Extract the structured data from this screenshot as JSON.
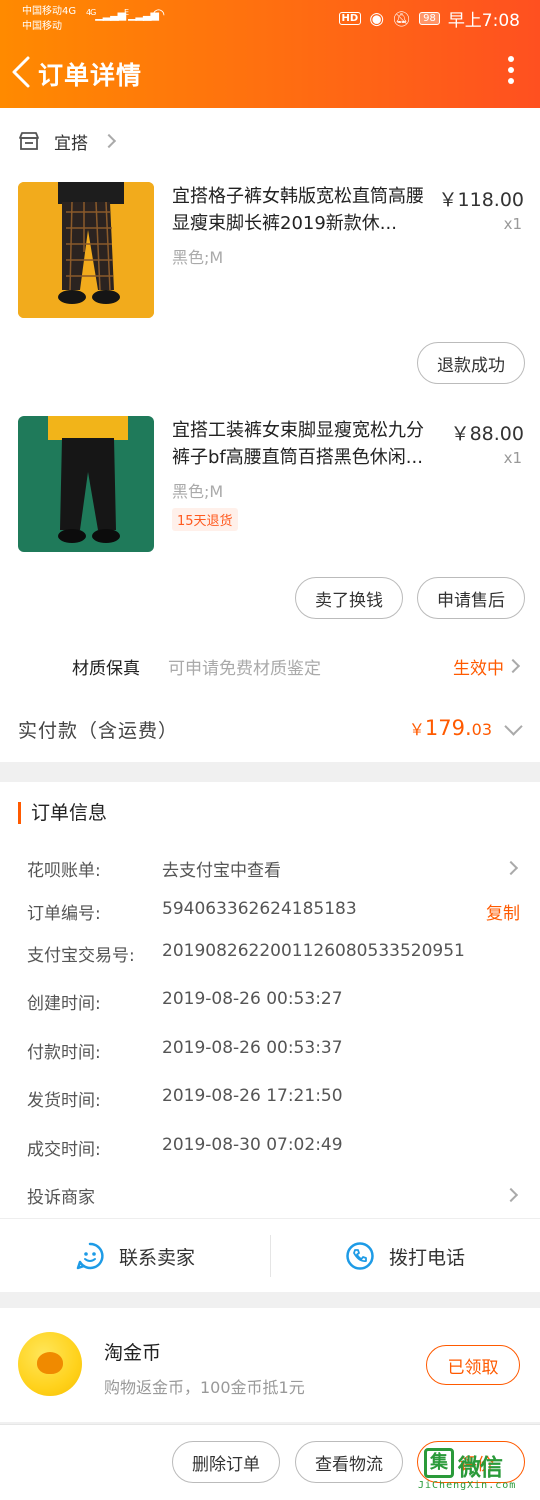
{
  "status_bar": {
    "carrier1": "中国移动4G",
    "carrier2": "中国移动",
    "sig1": "4G",
    "sig2": "E",
    "hd": "HD",
    "battery": "98",
    "time": "早上7:08"
  },
  "header": {
    "title": "订单详情"
  },
  "shop": {
    "name": "宜搭"
  },
  "items": [
    {
      "name": "宜搭格子裤女韩版宽松直筒高腰显瘦束脚长裤2019新款休...",
      "price": "￥118.00",
      "qty": "x1",
      "sku": "黑色;M",
      "action": "退款成功"
    },
    {
      "name": "宜搭工装裤女束脚显瘦宽松九分裤子bf高腰直筒百搭黑色休闲...",
      "price": "￥88.00",
      "qty": "x1",
      "sku": "黑色;M",
      "tag": "15天退货",
      "actions": [
        "卖了换钱",
        "申请售后"
      ]
    }
  ],
  "authenticity": {
    "title": "材质保真",
    "desc": "可申请免费材质鉴定",
    "status": "生效中"
  },
  "payment": {
    "label": "实付款（含运费）",
    "currency": "￥",
    "amount_int": "179.",
    "amount_dec": "03"
  },
  "order_info": {
    "title": "订单信息",
    "rows": [
      {
        "label": "花呗账单:",
        "value": "去支付宝中查看"
      },
      {
        "label": "订单编号:",
        "value": "594063362624185183",
        "action": "复制"
      },
      {
        "label": "支付宝交易号:",
        "value": "2019082622001126080533520951"
      },
      {
        "label": "创建时间:",
        "value": "2019-08-26 00:53:27"
      },
      {
        "label": "付款时间:",
        "value": "2019-08-26 00:53:37"
      },
      {
        "label": "发货时间:",
        "value": "2019-08-26 17:21:50"
      },
      {
        "label": "成交时间:",
        "value": "2019-08-30 07:02:49"
      },
      {
        "label": "投诉商家",
        "value": ""
      }
    ]
  },
  "contact": {
    "seller": "联系卖家",
    "phone": "拨打电话"
  },
  "coin": {
    "title": "淘金币",
    "desc": "购物返金币，100金币抵1元",
    "button": "已领取"
  },
  "bottom_bar": {
    "delete": "删除订单",
    "logistics": "查看物流",
    "review": "评价"
  },
  "watermark": {
    "icon_char": "集",
    "cn": "微信",
    "en": "JiChengXin.com"
  },
  "colors": {
    "accent": "#ff5a00",
    "header_gradient_start": "#ff8a00",
    "header_gradient_end": "#ff5020",
    "contact_icon": "#1e9be6"
  }
}
